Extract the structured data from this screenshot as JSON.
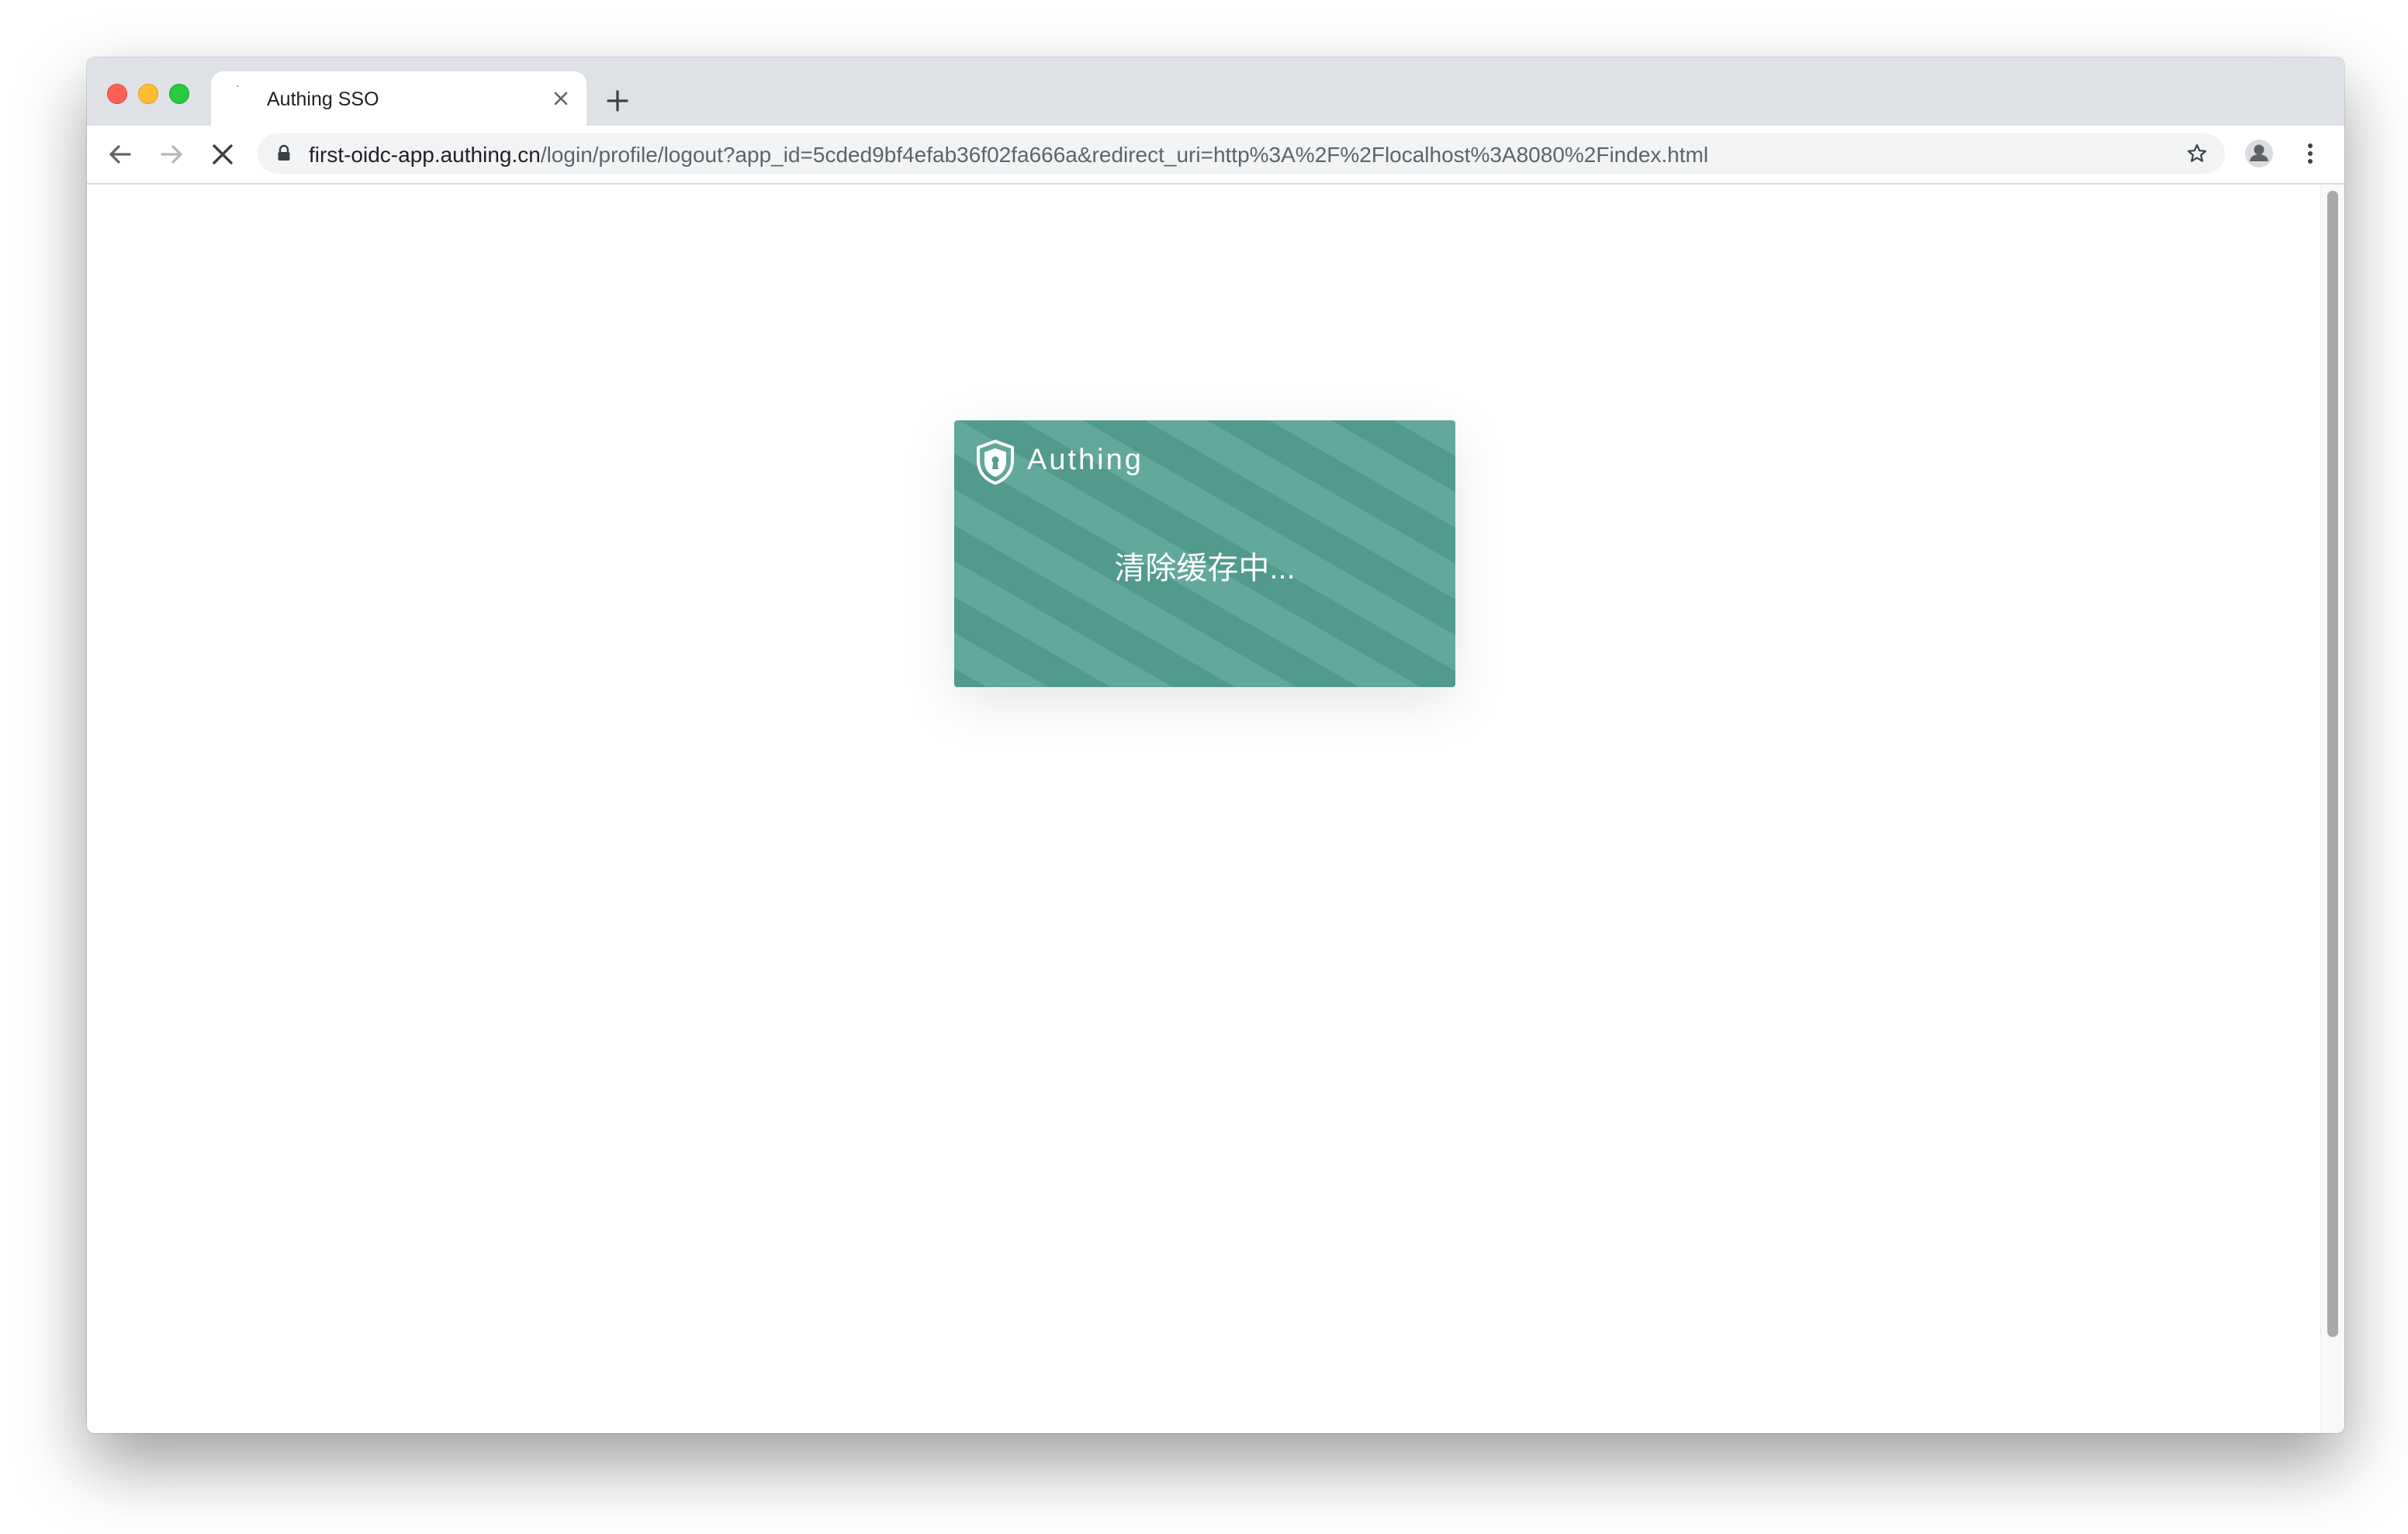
{
  "tab": {
    "title": "Authing SSO",
    "favicon": "loading-dot-icon"
  },
  "toolbar": {
    "back_icon": "arrow-left-icon",
    "forward_icon": "arrow-right-icon",
    "stop_icon": "stop-loading-icon",
    "url_host": "first-oidc-app.authing.cn",
    "url_path": "/login/profile/logout?app_id=5cded9bf4efab36f02fa666a&redirect_uri=http%3A%2F%2Flocalhost%3A8080%2Findex.html",
    "bookmark_icon": "star-icon",
    "profile_icon": "profile-avatar-icon",
    "menu_icon": "kebab-menu-icon"
  },
  "card": {
    "brand": "Authing",
    "message": "清除缓存中...",
    "accent_color": "#579e92"
  },
  "colors": {
    "tabstrip": "#dee1e6",
    "traffic_red": "#fe5f57",
    "traffic_yellow": "#febc2e",
    "traffic_green": "#28c840"
  }
}
